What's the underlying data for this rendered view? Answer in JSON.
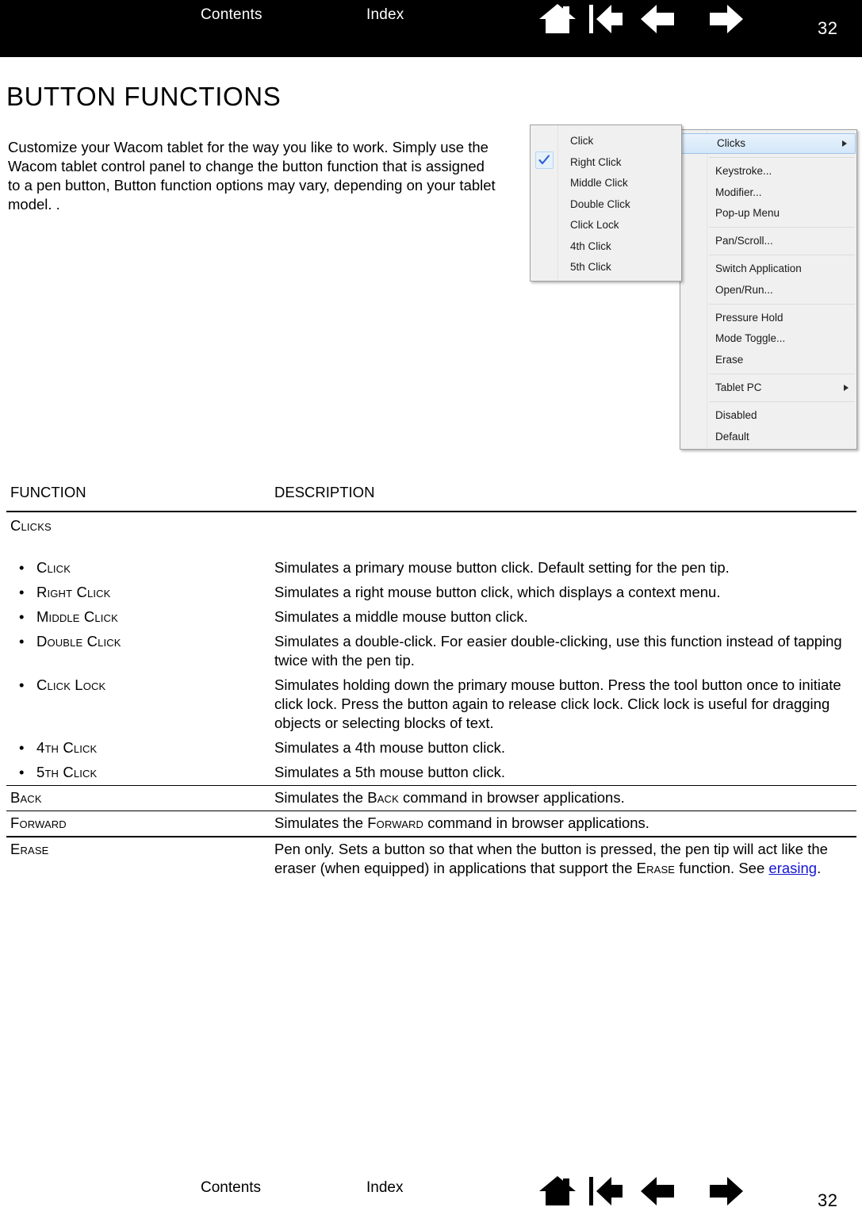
{
  "header": {
    "contents_label": "Contents",
    "index_label": "Index",
    "page_number": "32",
    "nav": [
      {
        "name": "home-icon",
        "label": "Home"
      },
      {
        "name": "first-page-icon",
        "label": "Go to first page"
      },
      {
        "name": "prev-page-icon",
        "label": "Previous page"
      },
      {
        "name": "next-page-icon",
        "label": "Next page"
      }
    ],
    "background_color": "#000000",
    "text_color": "#ffffff"
  },
  "page": {
    "title": "BUTTON FUNCTIONS",
    "intro": "Customize your Wacom tablet for the way you like to work. Simply use the Wacom tablet control panel to change the button function that is assigned to a pen button, Button function options may vary, depending on your tablet model. ."
  },
  "figure": {
    "submenu_clicks": {
      "checked_item": "Right Click",
      "items": [
        "Click",
        "Right Click",
        "Middle Click",
        "Double Click",
        "Click Lock",
        "4th Click",
        "5th Click"
      ]
    },
    "main_menu": {
      "highlighted_item": "Clicks",
      "groups": [
        {
          "items": [
            {
              "label": "Clicks",
              "submenu": true,
              "highlighted": true
            }
          ]
        },
        {
          "items": [
            {
              "label": "Keystroke..."
            },
            {
              "label": "Modifier..."
            },
            {
              "label": "Pop-up Menu"
            }
          ]
        },
        {
          "items": [
            {
              "label": "Pan/Scroll..."
            }
          ]
        },
        {
          "items": [
            {
              "label": "Switch Application"
            },
            {
              "label": "Open/Run..."
            }
          ]
        },
        {
          "items": [
            {
              "label": "Pressure Hold"
            },
            {
              "label": "Mode Toggle..."
            },
            {
              "label": "Erase"
            }
          ]
        },
        {
          "items": [
            {
              "label": "Tablet PC",
              "submenu": true
            }
          ]
        },
        {
          "items": [
            {
              "label": "Disabled"
            },
            {
              "label": "Default"
            }
          ]
        }
      ]
    }
  },
  "table": {
    "headers": {
      "function": "FUNCTION",
      "description": "DESCRIPTION"
    },
    "rows": [
      {
        "type": "group",
        "function": "Clicks",
        "description": ""
      },
      {
        "type": "bullet",
        "function": "Click",
        "description": "Simulates a primary mouse button click. Default setting for the pen tip."
      },
      {
        "type": "bullet",
        "function": "Right Click",
        "description": "Simulates a right mouse button click, which displays a context menu."
      },
      {
        "type": "bullet",
        "function": "Middle Click",
        "description": "Simulates a middle mouse button click."
      },
      {
        "type": "bullet",
        "function": "Double Click",
        "description": "Simulates a double-click. For easier double-clicking, use this function instead of tapping twice with the pen tip."
      },
      {
        "type": "bullet",
        "function": "Click Lock",
        "description": "Simulates holding down the primary mouse button. Press the tool button once to initiate click lock. Press the button again to release click lock. Click lock is useful for dragging objects or selecting blocks of text."
      },
      {
        "type": "bullet",
        "function": "4th Click",
        "description": "Simulates a 4th mouse button click."
      },
      {
        "type": "bullet",
        "function": "5th Click",
        "description": "Simulates a 5th mouse button click."
      },
      {
        "type": "row",
        "function": "Back",
        "description_parts": [
          {
            "text": "Simulates the "
          },
          {
            "text": "Back",
            "smallcaps": true
          },
          {
            "text": " command in browser applications."
          }
        ]
      },
      {
        "type": "row",
        "function": "Forward",
        "description_parts": [
          {
            "text": "Simulates the "
          },
          {
            "text": "Forward",
            "smallcaps": true
          },
          {
            "text": " command in browser applications."
          }
        ]
      },
      {
        "type": "row",
        "function": "Erase",
        "description_parts": [
          {
            "text": "Pen only. Sets a button so that when the button is pressed, the pen tip will act like the eraser (when equipped) in applications that support the "
          },
          {
            "text": "Erase",
            "smallcaps": true
          },
          {
            "text": " function. See "
          },
          {
            "text": "erasing",
            "link": true
          },
          {
            "text": "."
          }
        ]
      }
    ]
  },
  "footer": {
    "contents_label": "Contents",
    "index_label": "Index",
    "page_number": "32",
    "nav": [
      {
        "name": "home-icon",
        "label": "Home"
      },
      {
        "name": "first-page-icon",
        "label": "Go to first page"
      },
      {
        "name": "prev-page-icon",
        "label": "Previous page"
      },
      {
        "name": "next-page-icon",
        "label": "Next page"
      }
    ],
    "text_color": "#000000"
  },
  "colors": {
    "link": "#1414d2",
    "menu_background": "#f0f0f0",
    "menu_highlight": "#d3e7f9",
    "menu_border": "#a0a0a0"
  }
}
